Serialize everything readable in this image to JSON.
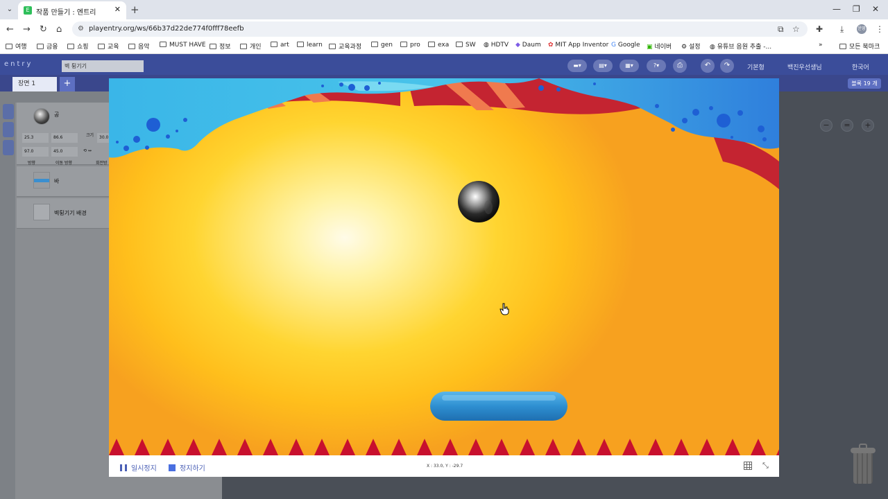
{
  "browser": {
    "tab_title": "작품 만들기 : 엔트리",
    "tab_favicon": "E",
    "url": "playentry.org/ws/66b37d22de774f0fff78eefb",
    "profile_initials": "운영"
  },
  "bookmarks": [
    "여행",
    "금융",
    "쇼핑",
    "교육",
    "음악",
    "MUST HAVE",
    "정보",
    "개인",
    "art",
    "learn",
    "교육과정",
    "gen",
    "pro",
    "exa",
    "SW",
    "HDTV",
    "Daum",
    "MIT App Inventor",
    "Google",
    "네이버",
    "설정",
    "유튜브 음원 추출 -...",
    "모든 북마크"
  ],
  "app": {
    "logo": "entry",
    "project_name": "벽 튕기기",
    "menu_basic": "기본형",
    "menu_user": "백진우선생님",
    "menu_lang": "한국어",
    "scene_tab": "장면 1",
    "block_count": "블록 19 개"
  },
  "objects": [
    {
      "name": "공"
    },
    {
      "name": "바"
    },
    {
      "name": "벽튕기기 배경"
    }
  ],
  "object_props": {
    "x": "25.3",
    "y": "86.6",
    "size_label": "크기",
    "size": "30.0",
    "direction": "97.0",
    "move_direction": "45.0",
    "direction_label": "방향",
    "move_direction_label": "이동 방향",
    "rotation_label": "회전방"
  },
  "stage": {
    "pause_label": "일시정지",
    "stop_label": "정지하기",
    "coordinates": "X : 33.0,  Y : -29.7"
  },
  "colors": {
    "accent": "#3b4d9a",
    "paddle": "#3a8fd0",
    "spikes": "#c8102e",
    "water": "#3ab6e8"
  }
}
